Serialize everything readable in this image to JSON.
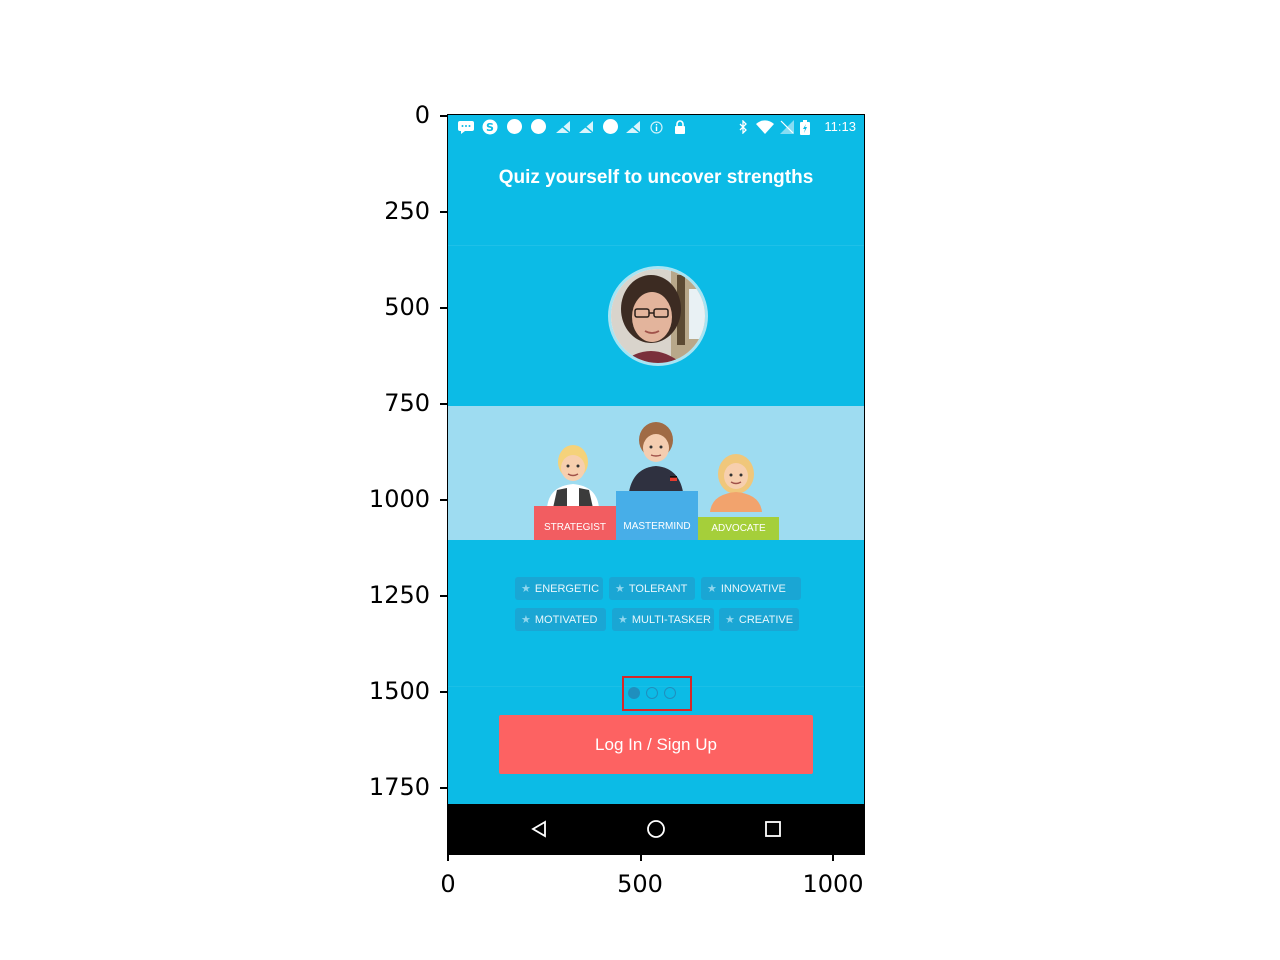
{
  "axes": {
    "y_ticks": [
      "0",
      "250",
      "500",
      "750",
      "1000",
      "1250",
      "1500",
      "1750"
    ],
    "x_ticks": [
      "0",
      "500",
      "1000"
    ]
  },
  "status_bar": {
    "time": "11:13",
    "icons": [
      "message-icon",
      "skype-icon",
      "dot-icon",
      "dot-icon",
      "signal-muted-icon",
      "signal-muted-icon",
      "dot-icon",
      "signal-muted-icon",
      "info-icon",
      "lock-icon",
      "bluetooth-icon",
      "wifi-icon",
      "no-sim-icon",
      "battery-icon"
    ]
  },
  "screen": {
    "title": "Quiz yourself to uncover strengths",
    "roles": [
      "STRATEGIST",
      "MASTERMIND",
      "ADVOCATE"
    ],
    "tags_row1": [
      "ENERGETIC",
      "TOLERANT",
      "INNOVATIVE"
    ],
    "tags_row2": [
      "MOTIVATED",
      "MULTI-TASKER",
      "CREATIVE"
    ],
    "page_indicator": {
      "count": 3,
      "active": 0
    },
    "login_button": "Log In / Sign Up"
  },
  "colors": {
    "background": "#0cbbe6",
    "illustration_band": "#9edcf1",
    "strategist": "#f25d61",
    "mastermind": "#47aee8",
    "advocate": "#a5cf3a",
    "login_button": "#fd6262",
    "highlight": "#d62728"
  }
}
